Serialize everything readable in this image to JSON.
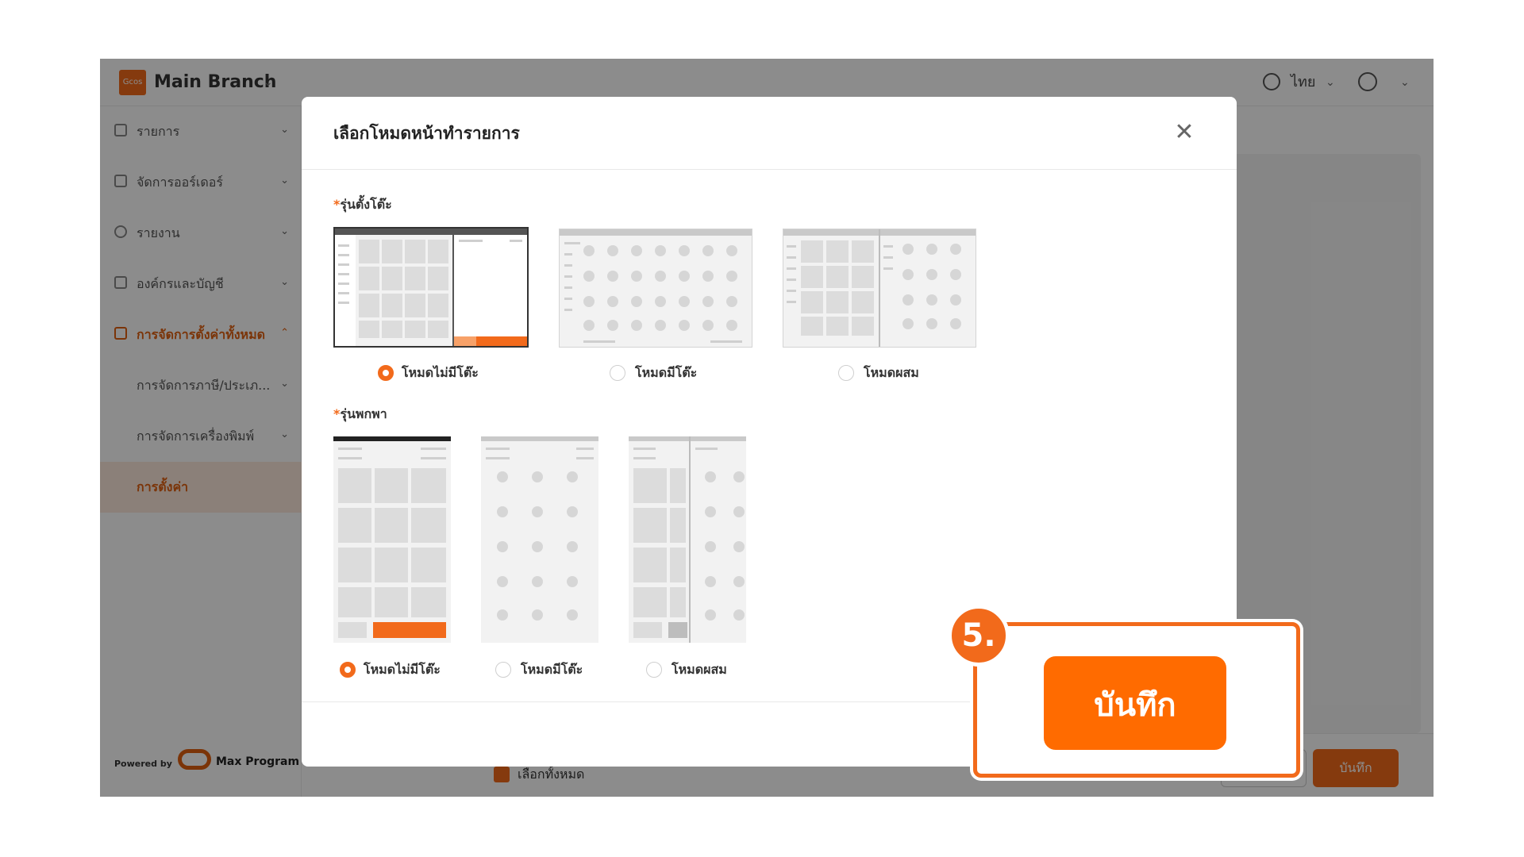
{
  "topbar": {
    "logo_text": "Gcos",
    "branch_name": "Main Branch",
    "language": "ไทย"
  },
  "sidebar": {
    "items": [
      {
        "label": "รายการ"
      },
      {
        "label": "จัดการออร์เดอร์"
      },
      {
        "label": "รายงาน"
      },
      {
        "label": "องค์กรและบัญชี"
      },
      {
        "label": "การจัดการตั้งค่าทั้งหมด"
      },
      {
        "label": "การจัดการภาษี/ประเภ..."
      },
      {
        "label": "การจัดการเครื่องพิมพ์"
      },
      {
        "label": "การตั้งค่า"
      }
    ],
    "powered_by": "Powered by",
    "brand": "Max Program"
  },
  "background": {
    "select_all": "เลือกทั้งหมด",
    "save_label": "บันทึก"
  },
  "modal": {
    "title": "เลือกโหมดหน้าทำรายการ",
    "close_icon": "close-icon",
    "dine_in": {
      "label": "รุ่นตั้งโต๊ะ",
      "options": [
        {
          "label": "โหมดไม่มีโต๊ะ",
          "selected": true
        },
        {
          "label": "โหมดมีโต๊ะ",
          "selected": false
        },
        {
          "label": "โหมดผสม",
          "selected": false
        }
      ]
    },
    "portable": {
      "label": "รุ่นพกพา",
      "options": [
        {
          "label": "โหมดไม่มีโต๊ะ",
          "selected": true
        },
        {
          "label": "โหมดมีโต๊ะ",
          "selected": false
        },
        {
          "label": "โหมดผสม",
          "selected": false
        }
      ]
    }
  },
  "highlight": {
    "step": "5.",
    "save_label": "บันทึก"
  },
  "colors": {
    "accent": "#f26a1b",
    "highlight": "#ff6b00"
  }
}
